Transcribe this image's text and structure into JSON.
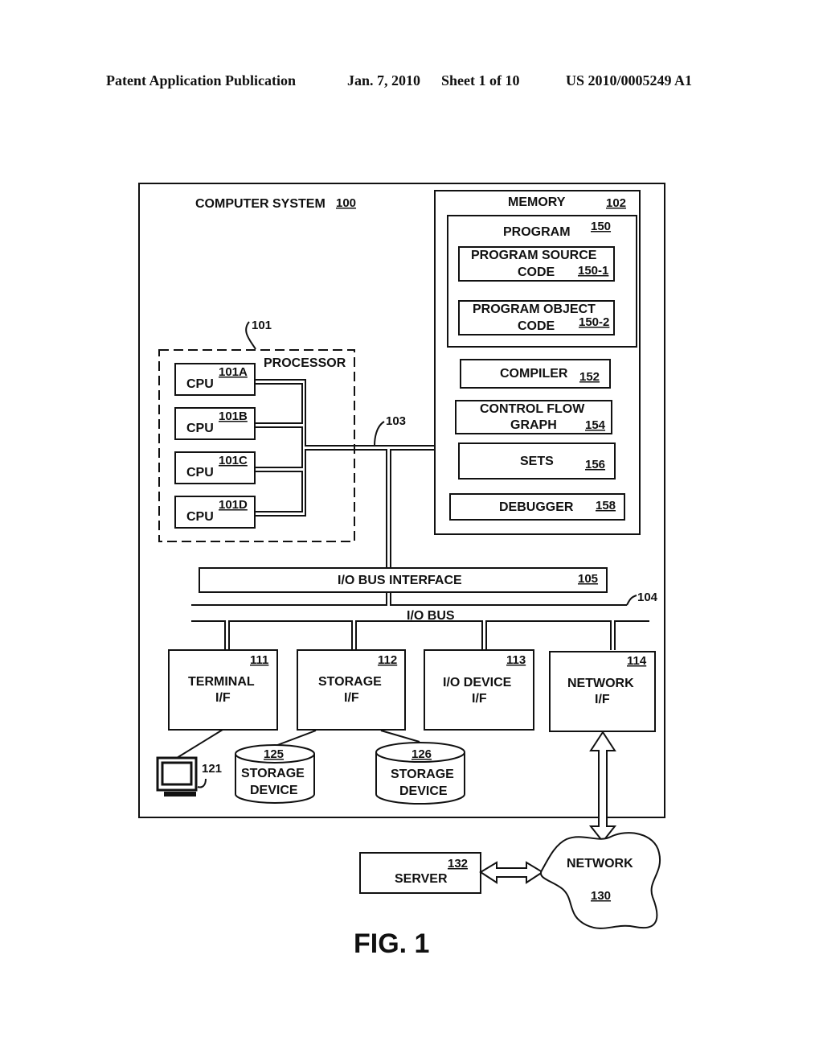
{
  "header": {
    "publication": "Patent Application Publication",
    "date": "Jan. 7, 2010",
    "sheet": "Sheet 1 of 10",
    "number": "US 2010/0005249 A1"
  },
  "diagram": {
    "computer_system": {
      "label": "COMPUTER SYSTEM",
      "ref": "100"
    },
    "memory": {
      "label": "MEMORY",
      "ref": "102"
    },
    "program": {
      "label": "PROGRAM",
      "ref": "150"
    },
    "program_source": {
      "line1": "PROGRAM SOURCE",
      "line2": "CODE",
      "ref": "150-1"
    },
    "program_object": {
      "line1": "PROGRAM OBJECT",
      "line2": "CODE",
      "ref": "150-2"
    },
    "compiler": {
      "label": "COMPILER",
      "ref": "152"
    },
    "cfg": {
      "line1": "CONTROL FLOW",
      "line2": "GRAPH",
      "ref": "154"
    },
    "sets": {
      "label": "SETS",
      "ref": "156"
    },
    "debugger": {
      "label": "DEBUGGER",
      "ref": "158"
    },
    "processor": {
      "label": "PROCESSOR",
      "ref": "101"
    },
    "cpus": [
      {
        "label": "CPU",
        "ref": "101A"
      },
      {
        "label": "CPU",
        "ref": "101B"
      },
      {
        "label": "CPU",
        "ref": "101C"
      },
      {
        "label": "CPU",
        "ref": "101D"
      }
    ],
    "memory_bus_ref": "103",
    "io_bus_interface": {
      "label": "I/O BUS INTERFACE",
      "ref": "105"
    },
    "io_bus": {
      "label": "I/O BUS",
      "ref": "104"
    },
    "interfaces": [
      {
        "line1": "TERMINAL",
        "line2": "I/F",
        "ref": "111"
      },
      {
        "line1": "STORAGE",
        "line2": "I/F",
        "ref": "112"
      },
      {
        "line1": "I/O DEVICE",
        "line2": "I/F",
        "ref": "113"
      },
      {
        "line1": "NETWORK",
        "line2": "I/F",
        "ref": "114"
      }
    ],
    "terminal_ref": "121",
    "storage_devices": [
      {
        "line1": "STORAGE",
        "line2": "DEVICE",
        "ref": "125"
      },
      {
        "line1": "STORAGE",
        "line2": "DEVICE",
        "ref": "126"
      }
    ],
    "server": {
      "label": "SERVER",
      "ref": "132"
    },
    "network": {
      "label": "NETWORK",
      "ref": "130"
    },
    "figure_label": "FIG. 1"
  }
}
